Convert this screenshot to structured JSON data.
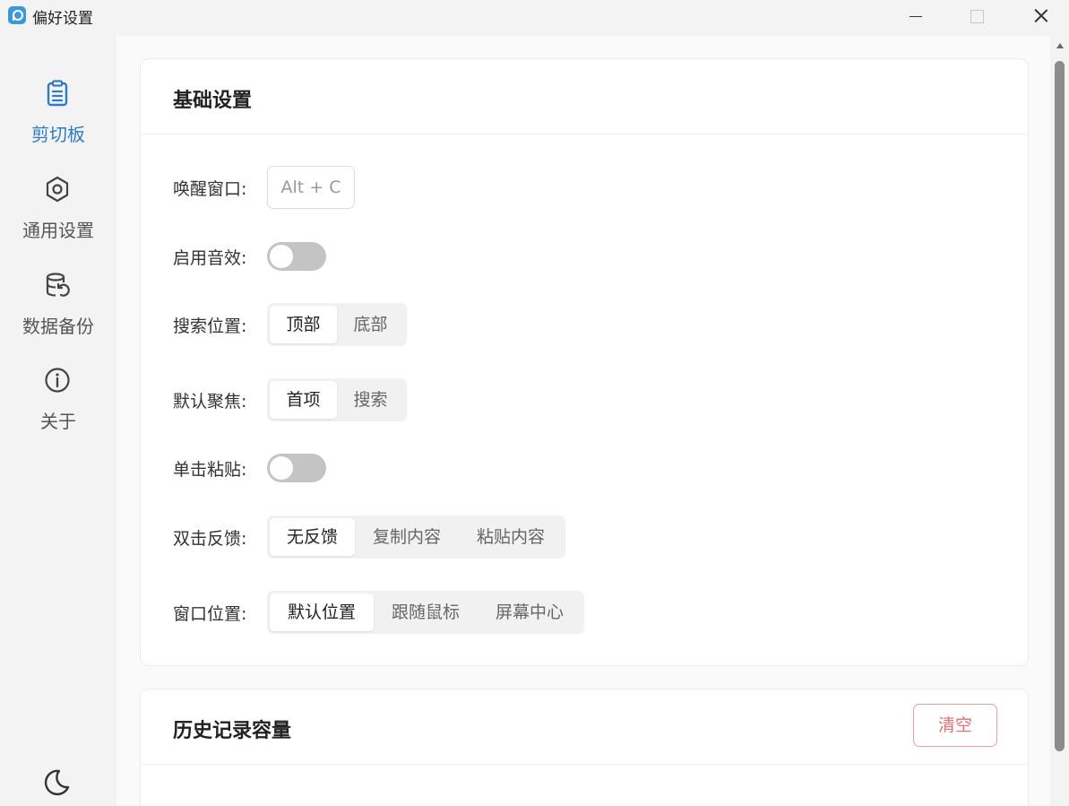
{
  "window": {
    "title": "偏好设置"
  },
  "sidebar": {
    "items": [
      {
        "label": "剪切板",
        "icon": "clipboard-icon",
        "active": true
      },
      {
        "label": "通用设置",
        "icon": "gear-icon",
        "active": false
      },
      {
        "label": "数据备份",
        "icon": "database-backup-icon",
        "active": false
      },
      {
        "label": "关于",
        "icon": "info-icon",
        "active": false
      }
    ],
    "theme_icon": "moon-icon"
  },
  "basic_settings": {
    "title": "基础设置",
    "wake_window": {
      "label": "唤醒窗口:",
      "value": "Alt + C"
    },
    "sound": {
      "label": "启用音效:",
      "enabled": false
    },
    "search_position": {
      "label": "搜索位置:",
      "options": [
        "顶部",
        "底部"
      ],
      "selected": "顶部"
    },
    "default_focus": {
      "label": "默认聚焦:",
      "options": [
        "首项",
        "搜索"
      ],
      "selected": "首项"
    },
    "single_click_paste": {
      "label": "单击粘贴:",
      "enabled": false
    },
    "double_click_feedback": {
      "label": "双击反馈:",
      "options": [
        "无反馈",
        "复制内容",
        "粘贴内容"
      ],
      "selected": "无反馈"
    },
    "window_position": {
      "label": "窗口位置:",
      "options": [
        "默认位置",
        "跟随鼠标",
        "屏幕中心"
      ],
      "selected": "默认位置"
    }
  },
  "history": {
    "title": "历史记录容量",
    "clear_label": "清空"
  },
  "colors": {
    "accent": "#2f7cbf",
    "danger": "#e07373",
    "toggle_off": "#c4c4c4"
  }
}
